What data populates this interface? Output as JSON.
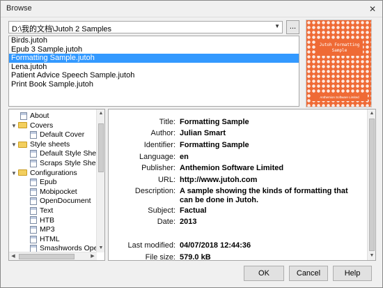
{
  "window": {
    "title": "Browse",
    "close_glyph": "✕"
  },
  "path_select": {
    "value": "D:\\我的文档\\Jutoh 2 Samples",
    "arrow": "▼"
  },
  "browse_button": {
    "label": "..."
  },
  "files": [
    {
      "name": "Birds.jutoh",
      "selected": false
    },
    {
      "name": "Epub 3 Sample.jutoh",
      "selected": false
    },
    {
      "name": "Formatting Sample.jutoh",
      "selected": true
    },
    {
      "name": "Lena.jutoh",
      "selected": false
    },
    {
      "name": "Patient Advice Speech Sample.jutoh",
      "selected": false
    },
    {
      "name": "Print Book Sample.jutoh",
      "selected": false
    }
  ],
  "cover": {
    "title": "Jutoh Formatting Sample",
    "author": "Anthemion Software Limited",
    "color": "#ef6a35"
  },
  "tree": [
    {
      "label": "About",
      "icon": "document-icon",
      "level": 1,
      "expander": ""
    },
    {
      "label": "Covers",
      "icon": "folder-icon",
      "level": 0,
      "expander": "▼"
    },
    {
      "label": "Default Cover",
      "icon": "document-icon",
      "level": 2,
      "expander": ""
    },
    {
      "label": "Style sheets",
      "icon": "folder-icon",
      "level": 0,
      "expander": "▼"
    },
    {
      "label": "Default Style Sheet",
      "icon": "document-icon",
      "level": 2,
      "expander": ""
    },
    {
      "label": "Scraps Style Sheet",
      "icon": "document-icon",
      "level": 2,
      "expander": ""
    },
    {
      "label": "Configurations",
      "icon": "folder-icon",
      "level": 0,
      "expander": "▼"
    },
    {
      "label": "Epub",
      "icon": "document-icon",
      "level": 2,
      "expander": ""
    },
    {
      "label": "Mobipocket",
      "icon": "document-icon",
      "level": 2,
      "expander": ""
    },
    {
      "label": "OpenDocument",
      "icon": "document-icon",
      "level": 2,
      "expander": ""
    },
    {
      "label": "Text",
      "icon": "document-icon",
      "level": 2,
      "expander": ""
    },
    {
      "label": "HTB",
      "icon": "document-icon",
      "level": 2,
      "expander": ""
    },
    {
      "label": "MP3",
      "icon": "document-icon",
      "level": 2,
      "expander": ""
    },
    {
      "label": "HTML",
      "icon": "document-icon",
      "level": 2,
      "expander": ""
    },
    {
      "label": "Smashwords OpenD",
      "icon": "document-icon",
      "level": 2,
      "expander": ""
    }
  ],
  "details": [
    {
      "label": "Title:",
      "value": "Formatting Sample"
    },
    {
      "label": "Author:",
      "value": "Julian Smart"
    },
    {
      "label": "Identifier:",
      "value": "Formatting Sample"
    },
    {
      "label": "Language:",
      "value": "en"
    },
    {
      "label": "Publisher:",
      "value": "Anthemion Software Limited"
    },
    {
      "label": "URL:",
      "value": "http://www.jutoh.com"
    },
    {
      "label": "Description:",
      "value": "A sample showing the kinds of formatting that can be done in Jutoh."
    },
    {
      "label": "Subject:",
      "value": "Factual"
    },
    {
      "label": "Date:",
      "value": "2013"
    },
    {
      "label": "Last modified:",
      "value": "04/07/2018 12:44:36"
    },
    {
      "label": "File size:",
      "value": "579.0 kB"
    }
  ],
  "buttons": {
    "ok": "OK",
    "cancel": "Cancel",
    "help": "Help"
  },
  "scroll_glyphs": {
    "up": "▲",
    "down": "▼",
    "left": "◀",
    "right": "▶"
  }
}
